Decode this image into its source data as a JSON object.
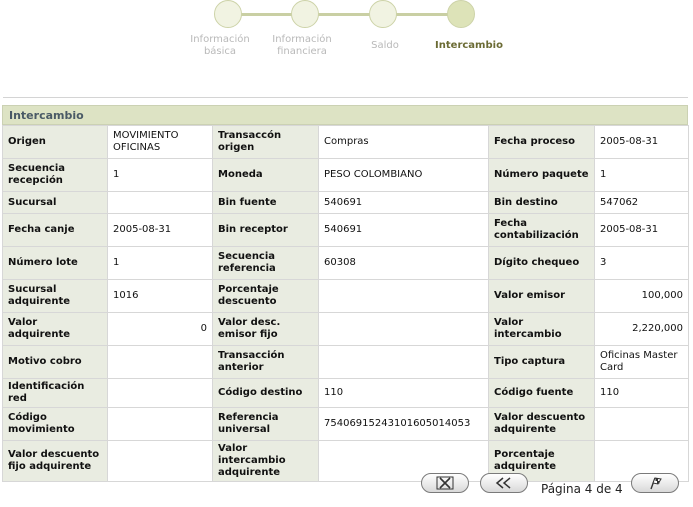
{
  "stepper": {
    "steps": [
      {
        "label_line1": "Información",
        "label_line2": "básica"
      },
      {
        "label_line1": "Información",
        "label_line2": "financiera"
      },
      {
        "label_line1": "Saldo",
        "label_line2": ""
      },
      {
        "label_line1": "Intercambio",
        "label_line2": ""
      }
    ]
  },
  "panel": {
    "title": "Intercambio",
    "rows": [
      [
        "Origen",
        "MOVIMIENTO OFICINAS",
        "Transaccón origen",
        "Compras",
        "Fecha proceso",
        "2005-08-31"
      ],
      [
        "Secuencia recepción",
        "1",
        "Moneda",
        "PESO COLOMBIANO",
        "Número paquete",
        "1"
      ],
      [
        "Sucursal",
        "",
        "Bin fuente",
        "540691",
        "Bin destino",
        "547062"
      ],
      [
        "Fecha canje",
        "2005-08-31",
        "Bin receptor",
        "540691",
        "Fecha contabilización",
        "2005-08-31"
      ],
      [
        "Número lote",
        "1",
        "Secuencia referencia",
        "60308",
        "Dígito chequeo",
        "3"
      ],
      [
        "Sucursal adquirente",
        "1016",
        "Porcentaje descuento",
        "",
        "Valor emisor",
        "100,000"
      ],
      [
        "Valor adquirente",
        "0",
        "Valor desc. emisor fijo",
        "",
        "Valor intercambio",
        "2,220,000"
      ],
      [
        "Motivo cobro",
        "",
        "Transacción anterior",
        "",
        "Tipo captura",
        "Oficinas Master Card"
      ],
      [
        "Identificación red",
        "",
        "Código destino",
        "110",
        "Código fuente",
        "110"
      ],
      [
        "Código movimiento",
        "",
        "Referencia universal",
        "75406915243101605014053",
        "Valor descuento adquirente",
        ""
      ],
      [
        "Valor descuento fijo adquirente",
        "",
        "Valor intercambio adquirente",
        "",
        "Porcentaje adquirente",
        ""
      ]
    ],
    "numeric_cells": [
      [
        5,
        5
      ],
      [
        6,
        1
      ],
      [
        6,
        5
      ]
    ]
  },
  "footer": {
    "close_icon": "close-x-icon",
    "back_icon": "double-chevron-left-icon",
    "page_label": "Página 4 de 4",
    "finish_icon": "checkered-flag-icon"
  }
}
